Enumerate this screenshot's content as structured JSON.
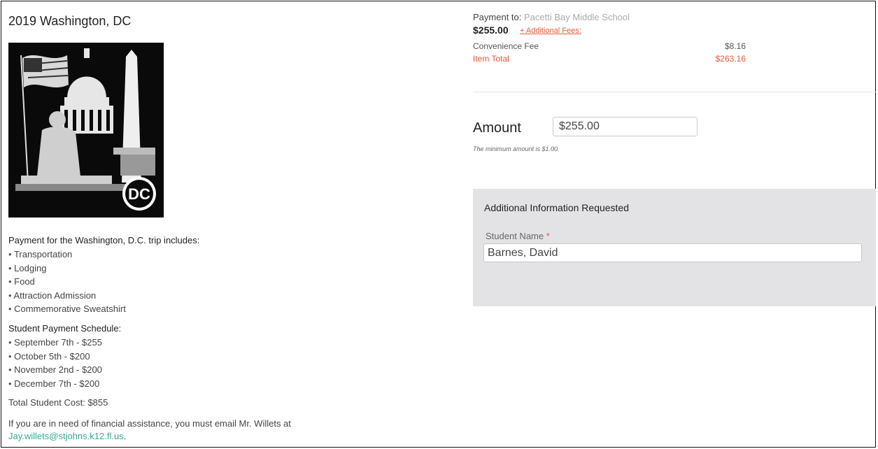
{
  "trip": {
    "title": "2019 Washington, DC",
    "image": {
      "description": "",
      "badge": "DC"
    }
  },
  "includes": {
    "heading": "Payment for the Washington, D.C. trip includes:",
    "items": [
      "Transportation",
      "Lodging",
      "Food",
      "Attraction Admission",
      "Commemorative Sweatshirt"
    ]
  },
  "schedule": {
    "heading": "Student Payment Schedule:",
    "items": [
      "September 7th - $255",
      "October 5th - $200",
      "November 2nd - $200",
      "December 7th - $200"
    ]
  },
  "total_cost": "Total Student Cost: $855",
  "assistance": {
    "text": "If you are in need of financial assistance, you must email Mr. Willets at",
    "email": "Jay.willets@stjohns.k12.fl.us",
    "suffix": "."
  },
  "payment": {
    "pay_to_label": "Payment to:",
    "school": "Pacetti Bay Middle School",
    "base_amount": "$255.00",
    "fees_link": "+ Additional Fees:",
    "convenience_fee_label": "Convenience Fee",
    "convenience_fee_value": "$8.16",
    "item_total_label": "Item Total",
    "item_total_value": "$263.16"
  },
  "amount": {
    "label": "Amount",
    "value": "$255.00",
    "hint": "The minimum amount is $1.00."
  },
  "additional_info": {
    "title": "Additional Information Requested",
    "student_name_label": "Student Name",
    "required_mark": "*",
    "student_name_value": "Barnes, David"
  },
  "colors": {
    "accent": "#e2593b",
    "link": "#3aa89b",
    "panel": "#e3e3e5"
  }
}
